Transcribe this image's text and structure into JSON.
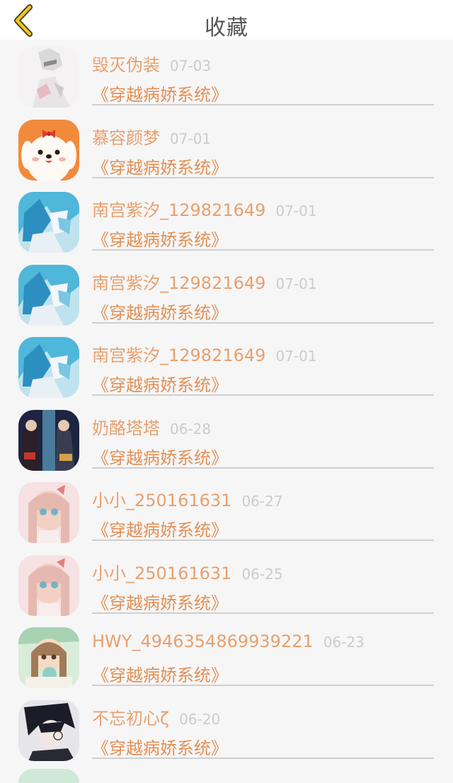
{
  "header": {
    "title": "收藏",
    "back_icon": "chevron-left-icon",
    "back_color": "#f0c419"
  },
  "items": [
    {
      "name": "毁灭伪装",
      "date": "07-03",
      "book": "《穿越病娇系统》",
      "avatar": "sketch"
    },
    {
      "name": "慕容颜梦",
      "date": "07-01",
      "book": "《穿越病娇系统》",
      "avatar": "dog"
    },
    {
      "name": "南宫紫汐_129821649",
      "date": "07-01",
      "book": "《穿越病娇系统》",
      "avatar": "blue"
    },
    {
      "name": "南宫紫汐_129821649",
      "date": "07-01",
      "book": "《穿越病娇系统》",
      "avatar": "blue"
    },
    {
      "name": "南宫紫汐_129821649",
      "date": "07-01",
      "book": "《穿越病娇系统》",
      "avatar": "blue"
    },
    {
      "name": "奶酪塔塔",
      "date": "06-28",
      "book": "《穿越病娇系统》",
      "avatar": "dark"
    },
    {
      "name": "小小_250161631",
      "date": "06-27",
      "book": "《穿越病娇系统》",
      "avatar": "pink"
    },
    {
      "name": "小小_250161631",
      "date": "06-25",
      "book": "《穿越病娇系统》",
      "avatar": "pink"
    },
    {
      "name": "HWY_4946354869939221",
      "date": "06-23",
      "book": "《穿越病娇系统》",
      "avatar": "green"
    },
    {
      "name": "不忘初心ζ",
      "date": "06-20",
      "book": "《穿越病娇系统》",
      "avatar": "mono"
    }
  ]
}
